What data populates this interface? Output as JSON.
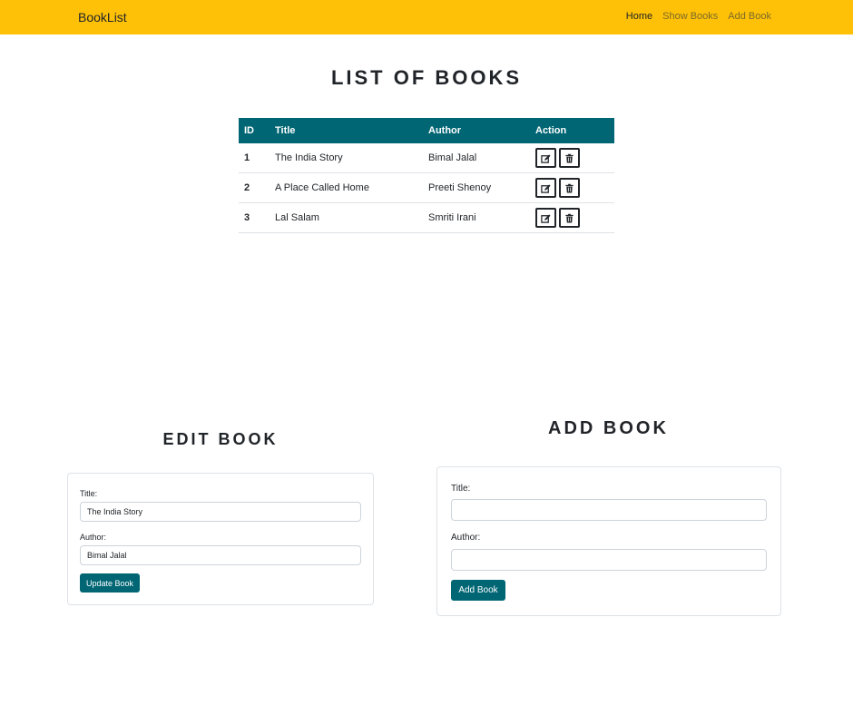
{
  "navbar": {
    "brand": "BookList",
    "links": [
      {
        "label": "Home"
      },
      {
        "label": "Show Books"
      },
      {
        "label": "Add Book"
      }
    ]
  },
  "list_section": {
    "heading": "LIST OF BOOKS",
    "columns": [
      "ID",
      "Title",
      "Author",
      "Action"
    ],
    "rows": [
      {
        "id": "1",
        "title": "The India Story",
        "author": "Bimal Jalal"
      },
      {
        "id": "2",
        "title": "A Place Called Home",
        "author": "Preeti Shenoy"
      },
      {
        "id": "3",
        "title": "Lal Salam",
        "author": "Smriti Irani"
      }
    ],
    "action_icons": [
      "edit-icon",
      "trash-icon"
    ]
  },
  "edit_section": {
    "heading": "EDIT BOOK",
    "title_label": "Title:",
    "title_value": "The India Story",
    "author_label": "Author:",
    "author_value": "Bimal Jalal",
    "submit_label": "Update Book"
  },
  "add_section": {
    "heading": "ADD BOOK",
    "title_label": "Title:",
    "title_value": "",
    "author_label": "Author:",
    "author_value": "",
    "submit_label": "Add Book"
  },
  "colors": {
    "navbar_bg": "#ffc107",
    "accent": "#006674"
  }
}
